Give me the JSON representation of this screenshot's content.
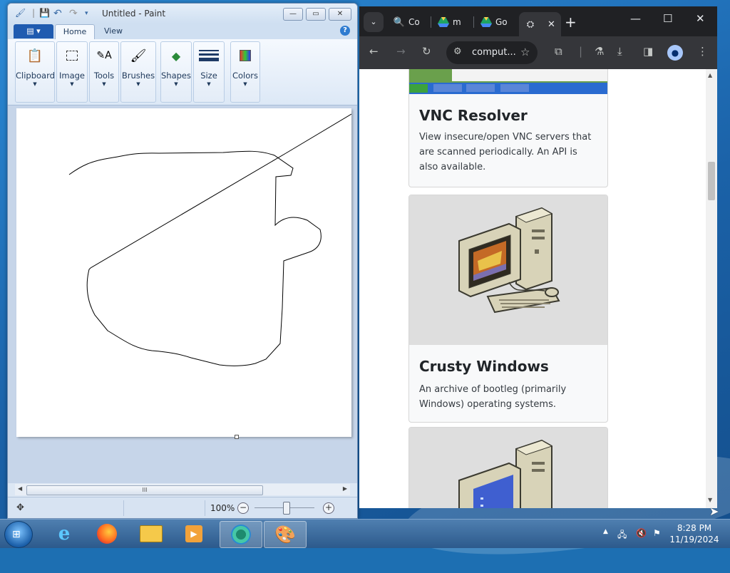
{
  "paint": {
    "title": "Untitled - Paint",
    "file_menu": "▤ ▾",
    "tabs": [
      "Home",
      "View"
    ],
    "groups": {
      "clipboard": "Clipboard",
      "image": "Image",
      "tools": "Tools",
      "brushes": "Brushes",
      "shapes": "Shapes",
      "size": "Size",
      "colors": "Colors"
    },
    "scroll_grip": "III",
    "zoom": "100%",
    "window_buttons": {
      "minimize": "—",
      "maximize": "▭",
      "close": "✕"
    }
  },
  "chrome": {
    "tabs": [
      {
        "label": "Co",
        "icon": "search-icon"
      },
      {
        "label": "m",
        "icon": "drive-icon"
      },
      {
        "label": "Go",
        "icon": "drive-icon"
      },
      {
        "label": "",
        "icon": "site-icon"
      }
    ],
    "new_tab": "+",
    "url": "comput...",
    "accent": "#a8c7fa"
  },
  "page": {
    "cards": [
      {
        "title": "VNC Resolver",
        "description": "View insecure/open VNC servers that are scanned periodically. An API is also available."
      },
      {
        "title": "Crusty Windows",
        "description": "An archive of bootleg (primarily Windows) operating systems."
      }
    ]
  },
  "taskbar": {
    "time": "8:28 PM",
    "date": "11/19/2024"
  }
}
